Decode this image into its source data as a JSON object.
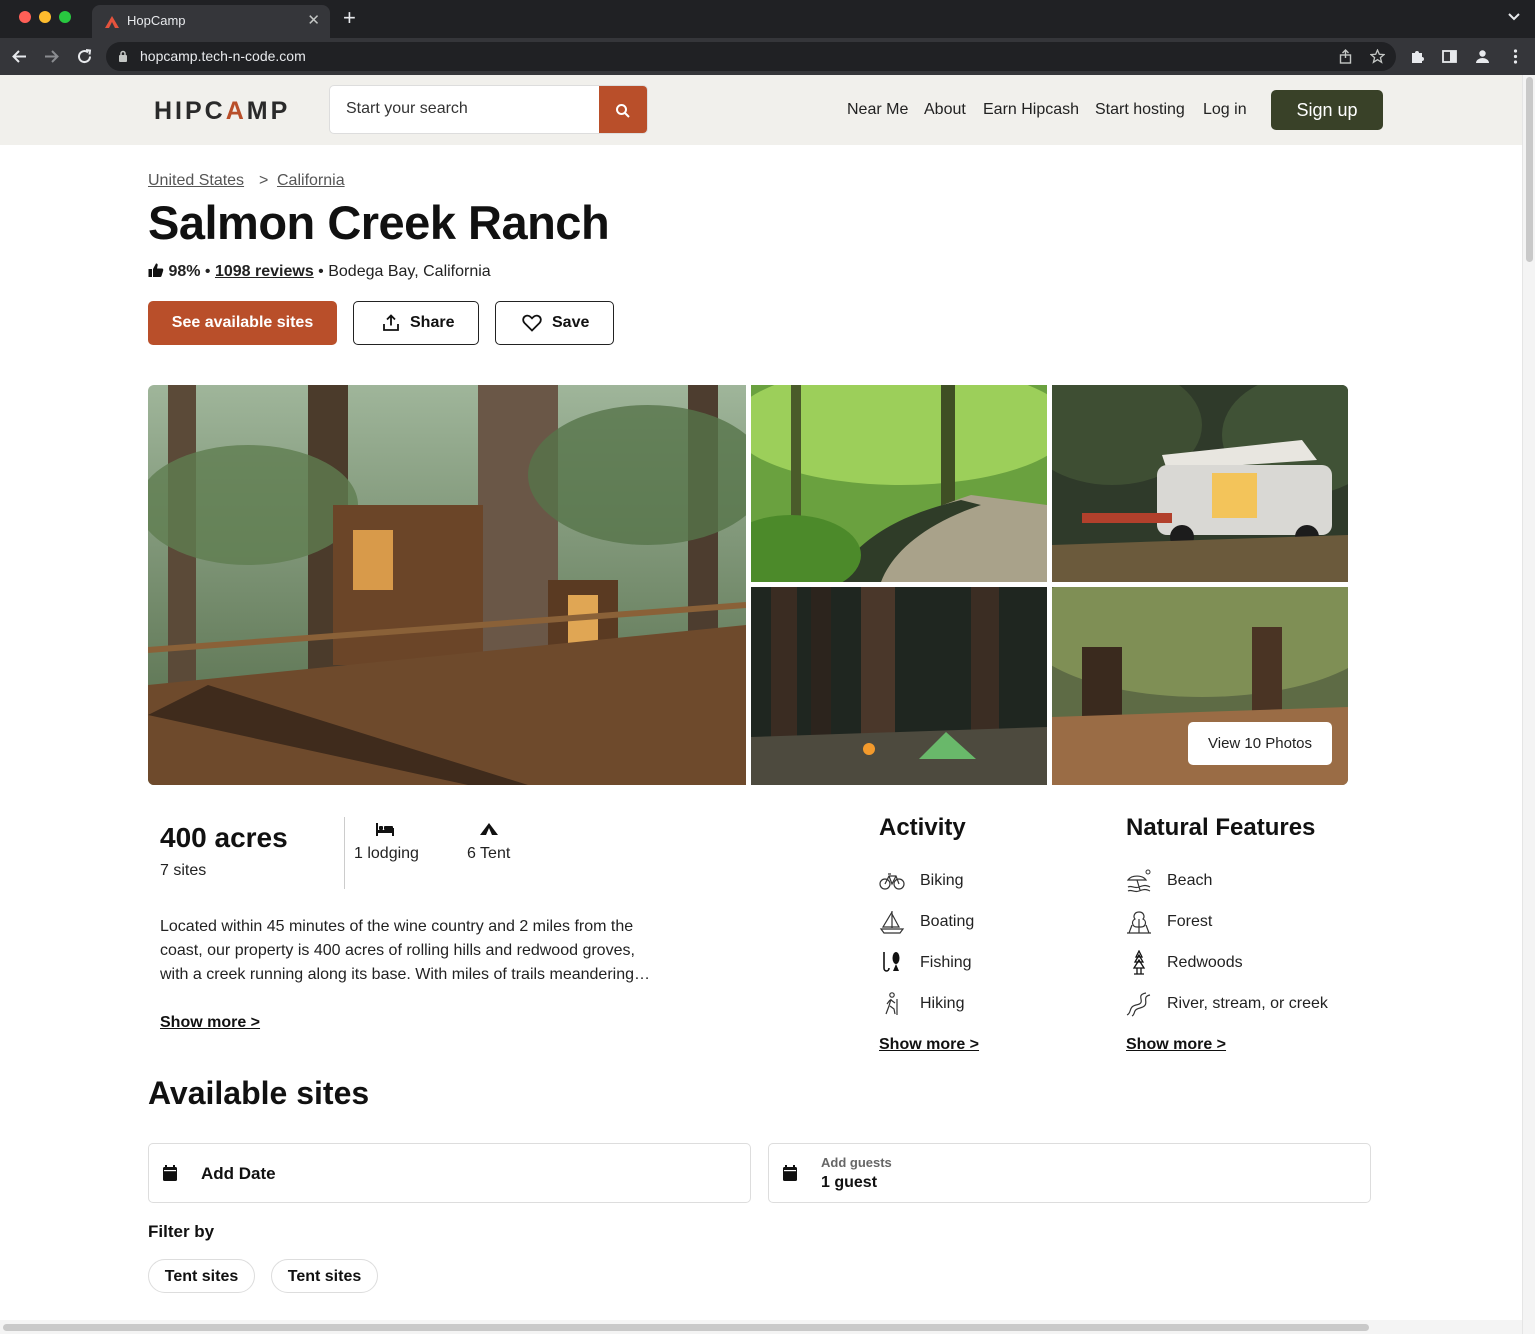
{
  "browser": {
    "tab_title": "HopCamp",
    "url": "hopcamp.tech-n-code.com"
  },
  "header": {
    "logo": {
      "part1": "HIPC",
      "part2": "A",
      "part3": "MP"
    },
    "search_placeholder": "Start your search",
    "nav": [
      "Near Me",
      "About",
      "Earn Hipcash",
      "Start hosting",
      "Log in"
    ],
    "signup_label": "Sign up"
  },
  "breadcrumb": {
    "items": [
      "United States",
      "California"
    ],
    "separator": ">"
  },
  "listing": {
    "title": "Salmon Creek Ranch",
    "rating": "98%",
    "reviews": "1098 reviews",
    "location": "Bodega Bay, California",
    "see_sites_label": "See available sites",
    "share_label": "Share",
    "save_label": "Save",
    "view_photos_label": "View 10 Photos"
  },
  "stats": {
    "acres": "400 acres",
    "sites": "7 sites",
    "lodging": "1 lodging",
    "tent": "6 Tent"
  },
  "description": {
    "text": "Located within 45 minutes of the wine country and 2 miles from the coast, our property is 400 acres of rolling hills and redwood groves, with a creek running along its base. With miles of trails meandering…",
    "show_more": "Show more >"
  },
  "activity": {
    "title": "Activity",
    "items": [
      {
        "label": "Biking",
        "icon": "bike-icon"
      },
      {
        "label": "Boating",
        "icon": "sailboat-icon"
      },
      {
        "label": "Fishing",
        "icon": "fishing-icon"
      },
      {
        "label": "Hiking",
        "icon": "hiker-icon"
      }
    ],
    "show_more": "Show more >"
  },
  "natural_features": {
    "title": "Natural Features",
    "items": [
      {
        "label": "Beach",
        "icon": "beach-icon"
      },
      {
        "label": "Forest",
        "icon": "forest-icon"
      },
      {
        "label": "Redwoods",
        "icon": "redwood-icon"
      },
      {
        "label": "River, stream, or creek",
        "icon": "river-icon"
      }
    ],
    "show_more": "Show more >"
  },
  "available": {
    "title": "Available sites",
    "date_label": "Add Date",
    "guests_label": "Add guests",
    "guests_value": "1 guest",
    "filter_title": "Filter by",
    "filters": [
      "Tent sites",
      "Tent sites"
    ]
  },
  "colors": {
    "brand_rust": "#b94f2a",
    "brand_green": "#394128",
    "header_bg": "#f1f0ec"
  }
}
